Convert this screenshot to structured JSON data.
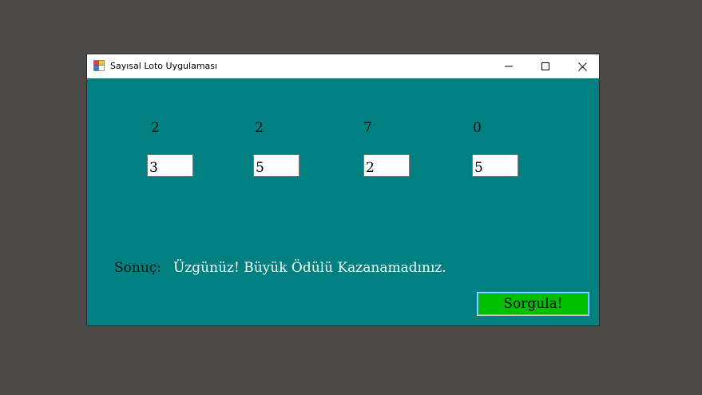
{
  "window": {
    "title": "Sayısal Loto Uygulaması"
  },
  "numbers": {
    "drawn": [
      "2",
      "2",
      "7",
      "0"
    ],
    "guesses": [
      "3",
      "5",
      "2",
      "5"
    ]
  },
  "result": {
    "label": "Sonuç:",
    "message": "Üzgünüz! Büyük Ödülü Kazanamadınız."
  },
  "actions": {
    "query_label": "Sorgula!"
  },
  "colors": {
    "desktop_bg": "#4b4a48",
    "form_bg": "#008080",
    "button_bg": "#00c000",
    "result_text": "#ffffff"
  }
}
